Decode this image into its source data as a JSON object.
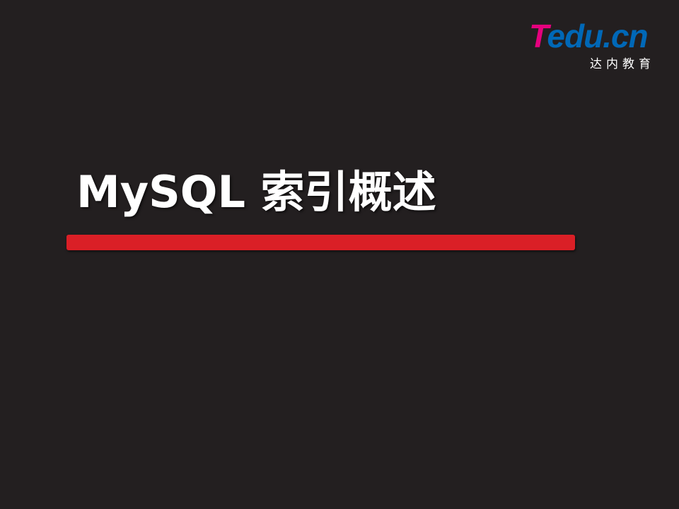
{
  "slide": {
    "title": "MySQL 索引概述",
    "accent_color": "#da1f26",
    "background_color": "#231f20"
  },
  "logo": {
    "mark_first": "T",
    "mark_rest": "edu.cn",
    "subtitle": "达内教育",
    "first_color": "#e5007e",
    "rest_color": "#0068b7"
  }
}
